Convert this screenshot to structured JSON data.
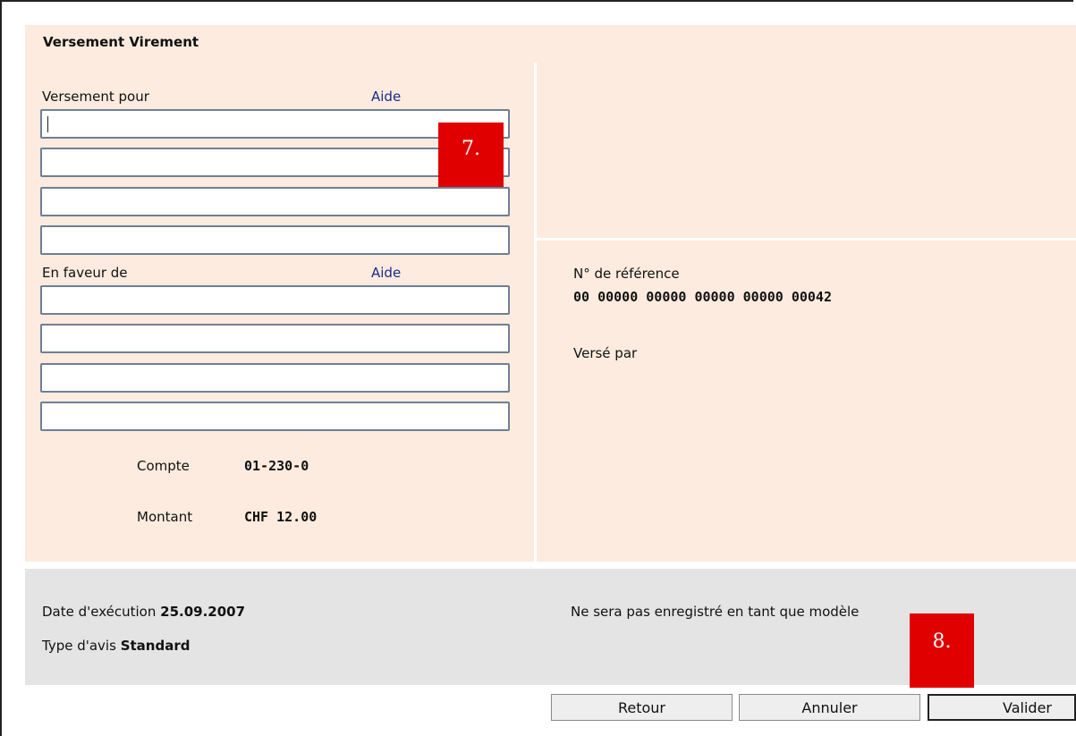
{
  "form": {
    "title": "Versement Virement",
    "versement_pour": {
      "label": "Versement pour",
      "help_link": "Aide",
      "lines": [
        "",
        "",
        "",
        ""
      ]
    },
    "en_faveur_de": {
      "label": "En faveur de",
      "help_link": "Aide",
      "lines": [
        "",
        "",
        "",
        ""
      ]
    },
    "compte": {
      "label": "Compte",
      "value": "01-230-0"
    },
    "montant": {
      "label": "Montant",
      "value": "CHF 12.00"
    },
    "reference": {
      "label": "N° de référence",
      "value": "00 00000 00000 00000 00000 00042"
    },
    "verse_par": {
      "label": "Versé par"
    }
  },
  "footer": {
    "date_label": "Date d'exécution",
    "date_value": "25.09.2007",
    "avis_label": "Type d'avis",
    "avis_value": "Standard",
    "modele_note": "Ne sera pas enregistré en tant que modèle"
  },
  "buttons": {
    "retour": "Retour",
    "annuler": "Annuler",
    "valider": "Valider"
  },
  "annotations": {
    "step7": "7.",
    "step8": "8."
  },
  "colors": {
    "form_bg": "#fcebde",
    "footer_bg": "#e4e4e4",
    "link": "#1a2a8a",
    "badge": "#e00000"
  }
}
